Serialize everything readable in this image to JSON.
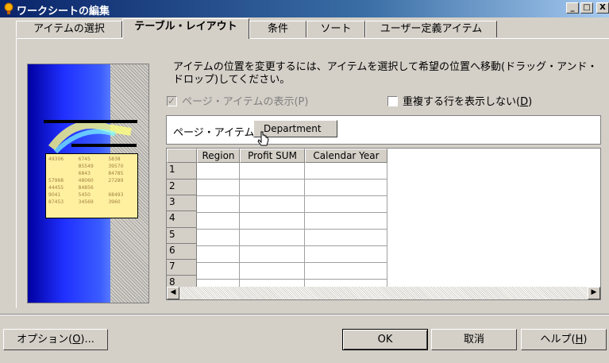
{
  "window": {
    "title": "ワークシートの編集",
    "minimize": "_",
    "maximize": "□",
    "close": "X"
  },
  "tabs": [
    {
      "label": "アイテムの選択",
      "active": false
    },
    {
      "label": "テーブル・レイアウト",
      "active": true
    },
    {
      "label": "条件",
      "active": false
    },
    {
      "label": "ソート",
      "active": false
    },
    {
      "label": "ユーザー定義アイテム",
      "active": false
    }
  ],
  "instructions": "アイテムの位置を変更するには、アイテムを選択して希望の位置へ移動(ドラッグ・アンド・ドロップ)してください。",
  "options": {
    "show_page_items": {
      "label": "ページ・アイテムの表示(P)",
      "checked": true,
      "enabled": false
    },
    "hide_duplicate_rows": {
      "label_pre": "重複する行を表示しない(",
      "mnemonic": "D",
      "label_post": ")",
      "checked": false,
      "enabled": true
    }
  },
  "page_items": {
    "label": "ページ・アイテム:",
    "items": [
      "Department"
    ]
  },
  "grid": {
    "columns": [
      "Region",
      "Profit SUM",
      "Calendar Year"
    ],
    "rows": [
      "1",
      "2",
      "3",
      "4",
      "5",
      "6",
      "7",
      "8"
    ],
    "scroll_left": "◀",
    "scroll_right": "▶"
  },
  "illustration": {
    "numbers": [
      "49306",
      "6745",
      "5838",
      "85549",
      "39570",
      "6843",
      "84785",
      "57968",
      "48060",
      "27289",
      "44455",
      "84856",
      "9041",
      "5450",
      "68493",
      "87453",
      "34569",
      "3960"
    ]
  },
  "buttons": {
    "options": {
      "label_pre": "オプション(",
      "mnemonic": "O",
      "label_post": ")..."
    },
    "ok": "OK",
    "cancel": "取消",
    "help": {
      "label_pre": "ヘルプ(",
      "mnemonic": "H",
      "label_post": ")"
    }
  },
  "colors": {
    "title_start": "#0a246a",
    "title_end": "#a6caf0",
    "face": "#d4d0c8"
  }
}
